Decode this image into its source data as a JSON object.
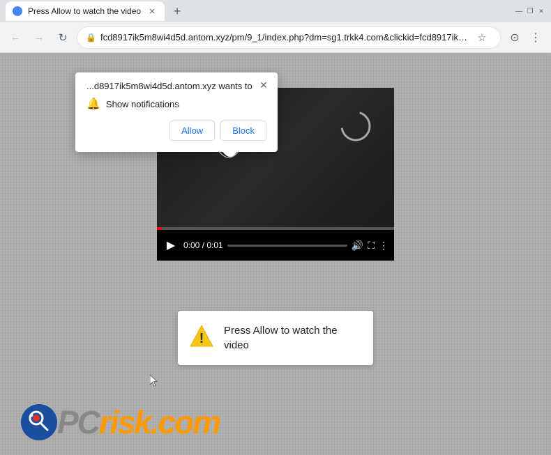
{
  "window": {
    "title": "Press Allow to watch the video",
    "controls": {
      "minimize": "—",
      "restore": "❐",
      "close": "✕"
    }
  },
  "tab": {
    "title": "Press Allow to watch the video",
    "favicon_color": "#4285f4"
  },
  "new_tab_btn": "+",
  "toolbar": {
    "back_icon": "←",
    "forward_icon": "→",
    "reload_icon": "↻",
    "lock_icon": "🔒",
    "address": "fcd8917ik5m8wi4d5d.antom.xyz/pm/9_1/index.php?dm=sg1.trkk4.com&clickid=fcd8917ik5...",
    "bookmark_icon": "☆",
    "account_icon": "👤",
    "menu_icon": "⋮",
    "avatar_icon": "⊙"
  },
  "notification_popup": {
    "site_text": "...d8917ik5m8wi4d5d.antom.xyz wants to",
    "close_icon": "✕",
    "permission_label": "Show notifications",
    "allow_label": "Allow",
    "block_label": "Block"
  },
  "video": {
    "time": "0:00 / 0:01",
    "play_icon": "▶",
    "volume_icon": "🔊",
    "fullscreen_icon": "⛶",
    "more_icon": "⋮"
  },
  "warning_box": {
    "text": "Press Allow to watch the video"
  },
  "pcrisk": {
    "pc": "PC",
    "risk": "risk",
    "domain": ".com"
  }
}
